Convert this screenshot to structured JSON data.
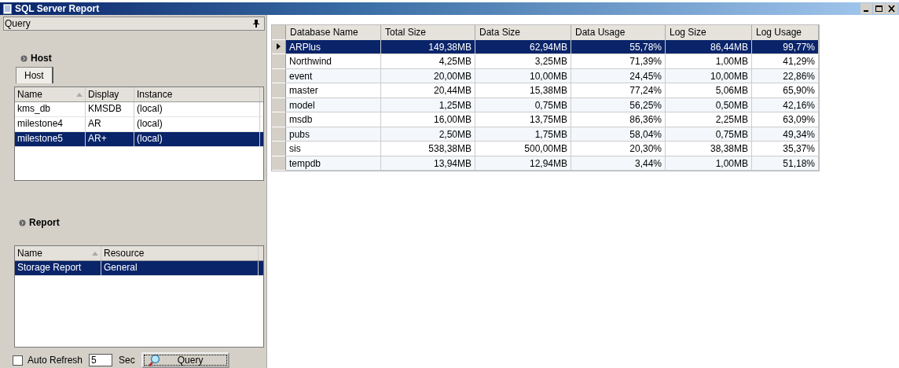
{
  "window": {
    "title": "SQL Server Report"
  },
  "query_panel": {
    "title": "Query",
    "host": {
      "heading": "Host",
      "tab": {
        "label": "Host",
        "selected": true
      },
      "columns": [
        "Name",
        "Display",
        "Instance"
      ],
      "rows": [
        {
          "cells": [
            "kms_db",
            "KMSDB",
            "(local)"
          ],
          "selected": false
        },
        {
          "cells": [
            "milestone4",
            "AR",
            "(local)"
          ],
          "selected": false
        },
        {
          "cells": [
            "milestone5",
            "AR+",
            "(local)"
          ],
          "selected": true
        }
      ]
    },
    "report": {
      "heading": "Report",
      "columns": [
        "Name",
        "Resource"
      ],
      "rows": [
        {
          "cells": [
            "Storage Report",
            "General"
          ],
          "selected": true
        }
      ]
    },
    "auto_refresh": {
      "label": "Auto Refresh",
      "checked": false
    },
    "interval": {
      "value": "5",
      "unit": "Sec"
    },
    "query_button": "Query"
  },
  "grid": {
    "columns": [
      "Database Name",
      "Total Size",
      "Data Size",
      "Data Usage",
      "Log Size",
      "Log Usage"
    ],
    "rows": [
      {
        "cells": [
          "ARPlus",
          "149,38MB",
          "62,94MB",
          "55,78%",
          "86,44MB",
          "99,77%"
        ],
        "selected": true
      },
      {
        "cells": [
          "Northwind",
          "4,25MB",
          "3,25MB",
          "71,39%",
          "1,00MB",
          "41,29%"
        ],
        "selected": false
      },
      {
        "cells": [
          "event",
          "20,00MB",
          "10,00MB",
          "24,45%",
          "10,00MB",
          "22,86%"
        ],
        "selected": false
      },
      {
        "cells": [
          "master",
          "20,44MB",
          "15,38MB",
          "77,24%",
          "5,06MB",
          "65,90%"
        ],
        "selected": false
      },
      {
        "cells": [
          "model",
          "1,25MB",
          "0,75MB",
          "56,25%",
          "0,50MB",
          "42,16%"
        ],
        "selected": false
      },
      {
        "cells": [
          "msdb",
          "16,00MB",
          "13,75MB",
          "86,36%",
          "2,25MB",
          "63,09%"
        ],
        "selected": false
      },
      {
        "cells": [
          "pubs",
          "2,50MB",
          "1,75MB",
          "58,04%",
          "0,75MB",
          "49,34%"
        ],
        "selected": false
      },
      {
        "cells": [
          "sis",
          "538,38MB",
          "500,00MB",
          "20,30%",
          "38,38MB",
          "35,37%"
        ],
        "selected": false
      },
      {
        "cells": [
          "tempdb",
          "13,94MB",
          "12,94MB",
          "3,44%",
          "1,00MB",
          "51,18%"
        ],
        "selected": false
      }
    ]
  }
}
